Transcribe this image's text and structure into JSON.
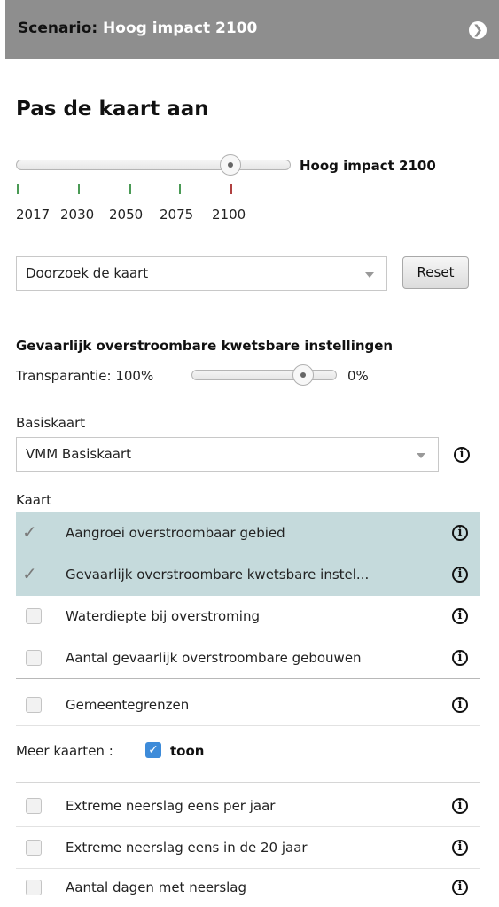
{
  "header": {
    "prefix": "Scenario:",
    "scenario": "Hoog impact 2100",
    "arrow_icon": "chevron-right-circle-icon"
  },
  "title": "Pas de kaart aan",
  "time_slider": {
    "selected_label": "Hoog impact 2100",
    "ticks": [
      "2017",
      "2030",
      "2050",
      "2075",
      "2100"
    ],
    "tick_colors": [
      "#4a9a55",
      "#4a9a55",
      "#4a9a55",
      "#4a9a55",
      "#b04040"
    ]
  },
  "search": {
    "value": "Doorzoek de kaart",
    "reset_label": "Reset"
  },
  "layer_title": "Gevaarlijk overstroombare kwetsbare instellingen",
  "transparency": {
    "label": "Transparantie: 100%",
    "end_label": "0%"
  },
  "basemap": {
    "label": "Basiskaart",
    "value": "VMM Basiskaart"
  },
  "map_label": "Kaart",
  "layers": [
    {
      "label": "Aangroei overstroombaar gebied",
      "checked": true
    },
    {
      "label": "Gevaarlijk overstroombare kwetsbare instel...",
      "checked": true
    },
    {
      "label": "Waterdiepte bij overstroming",
      "checked": false
    },
    {
      "label": "Aantal gevaarlijk overstroombare gebouwen",
      "checked": false
    },
    {
      "label": "Gemeentegrenzen",
      "checked": false
    }
  ],
  "more_maps": {
    "label": "Meer kaarten :",
    "toggle": "toon",
    "checked": true
  },
  "extra_layers": [
    {
      "label": "Extreme neerslag eens per jaar",
      "checked": false
    },
    {
      "label": "Extreme neerslag eens in de 20 jaar",
      "checked": false
    },
    {
      "label": "Aantal dagen met neerslag",
      "checked": false
    }
  ]
}
